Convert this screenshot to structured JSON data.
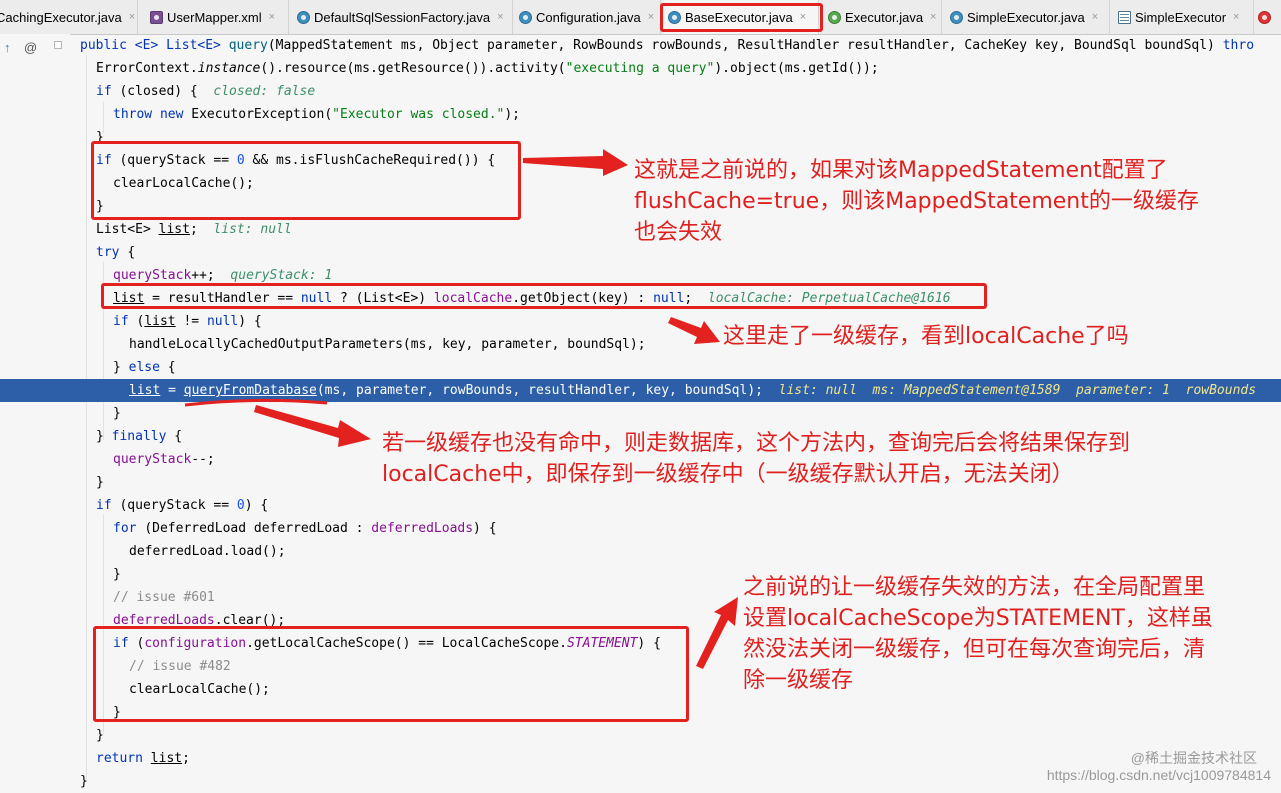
{
  "tabs": [
    {
      "label": "CachingExecutor.java",
      "icon": "java-class-icon"
    },
    {
      "label": "UserMapper.xml",
      "icon": "xml-file-icon"
    },
    {
      "label": "DefaultSqlSessionFactory.java",
      "icon": "java-class-icon"
    },
    {
      "label": "Configuration.java",
      "icon": "java-class-icon"
    },
    {
      "label": "BaseExecutor.java",
      "icon": "java-class-icon"
    },
    {
      "label": "Executor.java",
      "icon": "java-interface-icon"
    },
    {
      "label": "SimpleExecutor.java",
      "icon": "java-class-icon"
    },
    {
      "label": "SimpleExecutor",
      "icon": "structure-icon"
    }
  ],
  "active_tab": "BaseExecutor.java",
  "tab_close": "×",
  "gutter": {
    "override_marker": "↑",
    "annotation_marker": "@"
  },
  "code": {
    "signature": {
      "a": "public <E> List<E> ",
      "method": "query",
      "b": "(MappedStatement ms, Object parameter, RowBounds rowBounds, ResultHandler resultHandler, CacheKey key, BoundSql boundSql) ",
      "c": "thro"
    },
    "l1": {
      "a": "ErrorContext.",
      "b": "instance",
      "c": "().resource(ms.getResource()).activity(",
      "d": "\"executing a query\"",
      "e": ").object(ms.getId());"
    },
    "l2": {
      "a": "if ",
      "b": "(closed) {  ",
      "hint": "closed: false"
    },
    "l3": {
      "a": "throw new ",
      "b": "ExecutorException(",
      "c": "\"Executor was closed.\"",
      "d": ");"
    },
    "l4": "}",
    "l5": {
      "a": "if ",
      "b": "(queryStack == ",
      "c": "0",
      "d": " && ms.isFlushCacheRequired()) {"
    },
    "l6": "clearLocalCache();",
    "l7": "}",
    "l8": {
      "a": "List<E> ",
      "b": "list",
      "c": ";  ",
      "hint": "list: null"
    },
    "l9": {
      "a": "try ",
      "b": "{"
    },
    "l10": {
      "a": "queryStack",
      "b": "++;  ",
      "hint": "queryStack: 1"
    },
    "l11": {
      "a": "list",
      "b": " = resultHandler == ",
      "c": "null",
      "d": " ? (List<E>) ",
      "e": "localCache",
      "f": ".getObject(key) : ",
      "g": "null",
      "h": ";  ",
      "hint": "localCache: PerpetualCache@1616"
    },
    "l12": {
      "a": "if ",
      "b": "(",
      "c": "list",
      "d": " != ",
      "e": "null",
      "f": ") {"
    },
    "l13": "handleLocallyCachedOutputParameters(ms, key, parameter, boundSql);",
    "l14": {
      "a": "} ",
      "b": "else ",
      "c": "{"
    },
    "l15": {
      "a": "list",
      "b": " = ",
      "c": "queryFromDatabase",
      "d": "(ms, parameter, rowBounds, resultHandler, key, boundSql);  ",
      "hint": "list: null  ms: MappedStatement@1589  parameter: 1  rowBounds"
    },
    "l16": "}",
    "l17": {
      "a": "} ",
      "b": "finally ",
      "c": "{"
    },
    "l18": {
      "a": "queryStack",
      "b": "--;"
    },
    "l19": "}",
    "l20": {
      "a": "if ",
      "b": "(queryStack == ",
      "c": "0",
      "d": ") {"
    },
    "l21": {
      "a": "for ",
      "b": "(DeferredLoad deferredLoad : ",
      "c": "deferredLoads",
      "d": ") {"
    },
    "l22": "deferredLoad.load();",
    "l23": "}",
    "l24": "// issue #601",
    "l25": {
      "a": "deferredLoads",
      "b": ".clear();"
    },
    "l26": {
      "a": "if ",
      "b": "(",
      "c": "configuration",
      "d": ".getLocalCacheScope() == LocalCacheScope.",
      "e": "STATEMENT",
      "f": ") {"
    },
    "l27": "// issue #482",
    "l28": "clearLocalCache();",
    "l29": "}",
    "l30": "}",
    "l31": {
      "a": "return ",
      "b": "list",
      "c": ";"
    },
    "l32": "}"
  },
  "annotations": {
    "note1": [
      "这就是之前说的，如果对该MappedStatement配置了",
      "flushCache=true，则该MappedStatement的一级缓存",
      "也会失效"
    ],
    "note2": [
      "这里走了一级缓存，看到localCache了吗"
    ],
    "note3": [
      "若一级缓存也没有命中，则走数据库，这个方法内，查询完后会将结果保存到",
      "localCache中，即保存到一级缓存中（一级缓存默认开启，无法关闭）"
    ],
    "note4": [
      "之前说的让一级缓存失效的方法，在全局配置里",
      "设置localCacheScope为STATEMENT，这样虽",
      "然没法关闭一级缓存，但可在每次查询完后，清",
      "除一级缓存"
    ]
  },
  "colors": {
    "annotation_red": "#e3211e",
    "execution_line": "#2d5fa8"
  },
  "watermark": {
    "line1": "@稀土掘金技术社区",
    "line2": "https://blog.csdn.net/vcj1009784814"
  }
}
